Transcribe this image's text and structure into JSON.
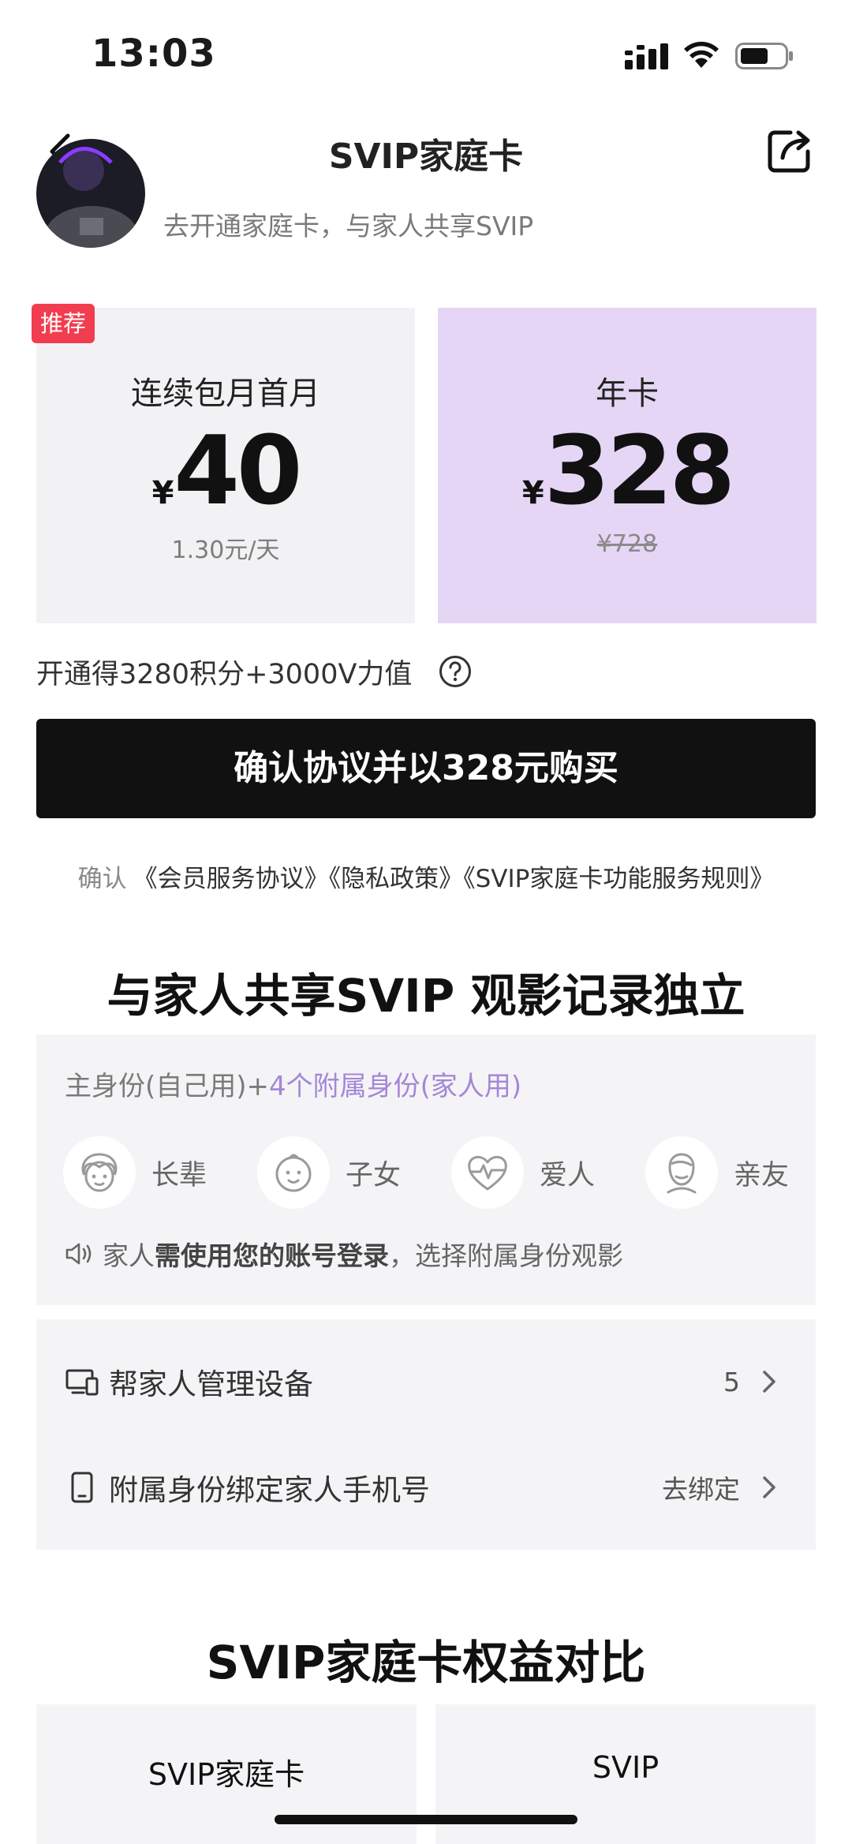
{
  "status_bar": {
    "time": "13:03"
  },
  "nav": {
    "title": "SVIP家庭卡"
  },
  "user": {
    "subtitle": "去开通家庭卡，与家人共享SVIP"
  },
  "plans": {
    "badge": "推荐",
    "monthly": {
      "name": "连续包月首月",
      "currency": "¥",
      "price": "40",
      "note": "1.30元/天"
    },
    "annual": {
      "name": "年卡",
      "currency": "¥",
      "price": "328",
      "original_price": "¥728"
    }
  },
  "points": {
    "text": "开通得3280积分+3000V力值"
  },
  "confirm_button": {
    "label": "确认协议并以328元购买"
  },
  "agreements": {
    "prefix": "确认",
    "links": [
      "《会员服务协议》",
      "《隐私政策》",
      "《SVIP家庭卡功能服务规则》"
    ]
  },
  "share_section": {
    "title": "与家人共享SVIP 观影记录独立",
    "desc_main": "主身份(自己用)+",
    "desc_highlight": "4个附属身份(家人用)",
    "roles": [
      {
        "label": "长辈",
        "icon": "elder-icon"
      },
      {
        "label": "子女",
        "icon": "child-icon"
      },
      {
        "label": "爱人",
        "icon": "heart-icon"
      },
      {
        "label": "亲友",
        "icon": "friend-icon"
      }
    ],
    "hint_prefix": "家人",
    "hint_bold": "需使用您的账号登录",
    "hint_suffix": "，选择附属身份观影"
  },
  "management": {
    "rows": [
      {
        "label": "帮家人管理设备",
        "value": "5"
      },
      {
        "label": "附属身份绑定家人手机号",
        "value": "去绑定"
      }
    ]
  },
  "compare_section": {
    "title": "SVIP家庭卡权益对比",
    "columns": [
      "SVIP家庭卡",
      "SVIP"
    ]
  },
  "colors": {
    "badge_red": "#f23c4f",
    "annual_card_purple": "#e6d6f6",
    "highlight_purple": "#a586d8",
    "confirm_button_black": "#111111"
  }
}
